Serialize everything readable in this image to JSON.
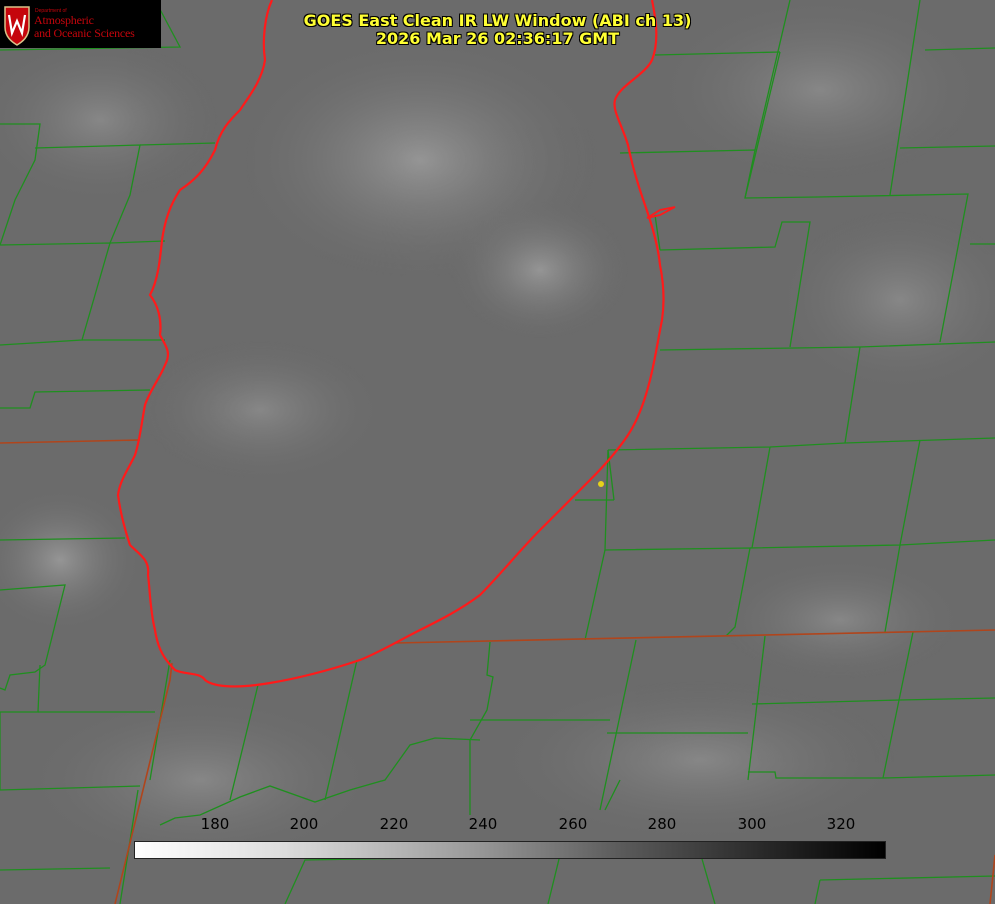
{
  "logo": {
    "department": "Department of",
    "line1": "Atmospheric",
    "line2": "and Oceanic Sciences",
    "seal_icon": "uw-crest-icon",
    "color": "#c5050c"
  },
  "title": {
    "line1": "GOES East Clean IR LW Window (ABI ch 13)",
    "line2": "2026 Mar 26 02:36:17 GMT",
    "color": "#ffff33"
  },
  "colorbar": {
    "ticks": [
      "180",
      "200",
      "220",
      "240",
      "260",
      "280",
      "300",
      "320"
    ],
    "colors": {
      "start": "#ffffff",
      "end": "#000000"
    }
  },
  "map": {
    "colors": {
      "county_lines": "#1f8f1f",
      "state_lines": "#b0451c",
      "lake_outline": "#ff1a1a",
      "marker": "#e6d21a",
      "background": "#6e6e6e"
    },
    "features": [
      "lake-michigan-outline",
      "county-boundaries",
      "state-boundaries",
      "location-marker"
    ]
  }
}
